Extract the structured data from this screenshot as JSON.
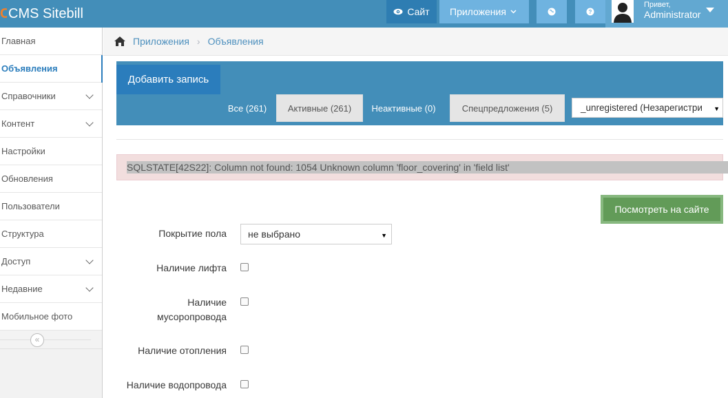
{
  "navbar": {
    "brand": "CMS Sitebill",
    "site_label": "Сайт",
    "apps_label": "Приложения",
    "user_greeting": "Привет,",
    "user_name": "Administrator",
    "accent_color": "#438eb9"
  },
  "sidebar": {
    "items": [
      {
        "label": "Главная"
      },
      {
        "label": "Объявления"
      },
      {
        "label": "Справочники"
      },
      {
        "label": "Контент"
      },
      {
        "label": "Настройки"
      },
      {
        "label": "Обновления"
      },
      {
        "label": "Пользователи"
      },
      {
        "label": "Структура"
      },
      {
        "label": "Доступ"
      },
      {
        "label": "Недавние"
      },
      {
        "label": "Мобильное фото"
      }
    ]
  },
  "breadcrumb": {
    "items": [
      "Приложения",
      "Объявления"
    ]
  },
  "panel": {
    "add_label": "Добавить запись",
    "tabs": [
      {
        "label": "Все (261)"
      },
      {
        "label": "Активные (261)"
      },
      {
        "label": "Неактивные (0)"
      },
      {
        "label": "Спецпредложения (5)"
      }
    ],
    "user_filter": "_unregistered (Незарегистри"
  },
  "alert": {
    "message": "SQLSTATE[42S22]: Column not found: 1054 Unknown column 'floor_covering' in 'field list'"
  },
  "view_on_site_label": "Посмотреть на сайте",
  "form": {
    "floor_label": "Покрытие пола",
    "floor_value": "не выбрано",
    "elevator_label": "Наличие лифта",
    "chute_label_1": "Наличие",
    "chute_label_2": "мусоропровода",
    "heating_label": "Наличие отопления",
    "water_label": "Наличие водопровода"
  }
}
